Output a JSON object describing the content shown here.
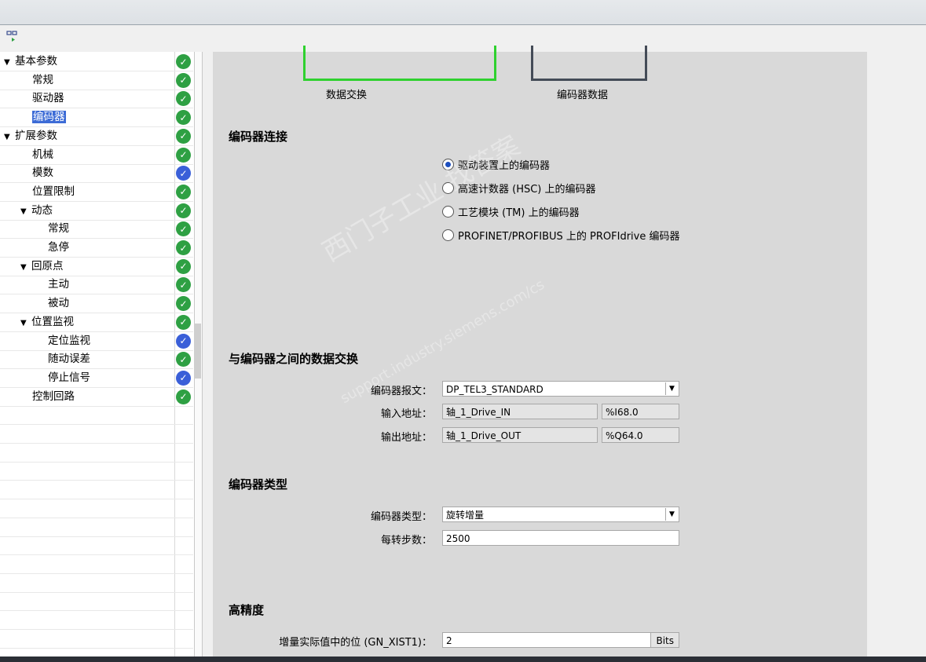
{
  "tree": {
    "items": [
      {
        "label": "基本参数",
        "level": 0,
        "arrow": "▼",
        "status": "ok"
      },
      {
        "label": "常规",
        "level": 1,
        "arrow": "",
        "status": "ok"
      },
      {
        "label": "驱动器",
        "level": 1,
        "arrow": "",
        "status": "ok"
      },
      {
        "label": "编码器",
        "level": 1,
        "arrow": "",
        "status": "ok",
        "selected": true
      },
      {
        "label": "扩展参数",
        "level": 0,
        "arrow": "▼",
        "status": "ok"
      },
      {
        "label": "机械",
        "level": 1,
        "arrow": "",
        "status": "ok"
      },
      {
        "label": "模数",
        "level": 1,
        "arrow": "",
        "status": "blue"
      },
      {
        "label": "位置限制",
        "level": 1,
        "arrow": "",
        "status": "ok"
      },
      {
        "label": "动态",
        "level": 1,
        "arrow": "▼",
        "status": "ok"
      },
      {
        "label": "常规",
        "level": 2,
        "arrow": "",
        "status": "ok"
      },
      {
        "label": "急停",
        "level": 2,
        "arrow": "",
        "status": "ok"
      },
      {
        "label": "回原点",
        "level": 1,
        "arrow": "▼",
        "status": "ok"
      },
      {
        "label": "主动",
        "level": 2,
        "arrow": "",
        "status": "ok"
      },
      {
        "label": "被动",
        "level": 2,
        "arrow": "",
        "status": "ok"
      },
      {
        "label": "位置监视",
        "level": 1,
        "arrow": "▼",
        "status": "ok"
      },
      {
        "label": "定位监视",
        "level": 2,
        "arrow": "",
        "status": "blue"
      },
      {
        "label": "随动误差",
        "level": 2,
        "arrow": "",
        "status": "ok"
      },
      {
        "label": "停止信号",
        "level": 2,
        "arrow": "",
        "status": "blue"
      },
      {
        "label": "控制回路",
        "level": 1,
        "arrow": "",
        "status": "ok"
      }
    ]
  },
  "diagram": {
    "left_caption": "数据交换",
    "right_caption": "编码器数据"
  },
  "encoder_connection": {
    "title": "编码器连接",
    "options": [
      {
        "label": "驱动装置上的编码器",
        "selected": true
      },
      {
        "label": "高速计数器 (HSC) 上的编码器",
        "selected": false
      },
      {
        "label": "工艺模块 (TM) 上的编码器",
        "selected": false
      },
      {
        "label": "PROFINET/PROFIBUS 上的 PROFIdrive 编码器",
        "selected": false
      }
    ]
  },
  "data_exchange": {
    "title": "与编码器之间的数据交换",
    "telegram_label": "编码器报文：",
    "telegram_value": "DP_TEL3_STANDARD",
    "input_label": "输入地址：",
    "input_name": "轴_1_Drive_IN",
    "input_addr": "%I68.0",
    "output_label": "输出地址：",
    "output_name": "轴_1_Drive_OUT",
    "output_addr": "%Q64.0"
  },
  "encoder_type": {
    "title": "编码器类型",
    "type_label": "编码器类型：",
    "type_value": "旋转增量",
    "steps_label": "每转步数：",
    "steps_value": "2500"
  },
  "precision": {
    "title": "高精度",
    "bits_label": "增量实际值中的位 (GN_XIST1)：",
    "bits_value": "2",
    "bits_unit": "Bits"
  },
  "watermark": {
    "line1": "西门子工业  找答案",
    "line2": "support.industry.siemens.com/cs"
  }
}
